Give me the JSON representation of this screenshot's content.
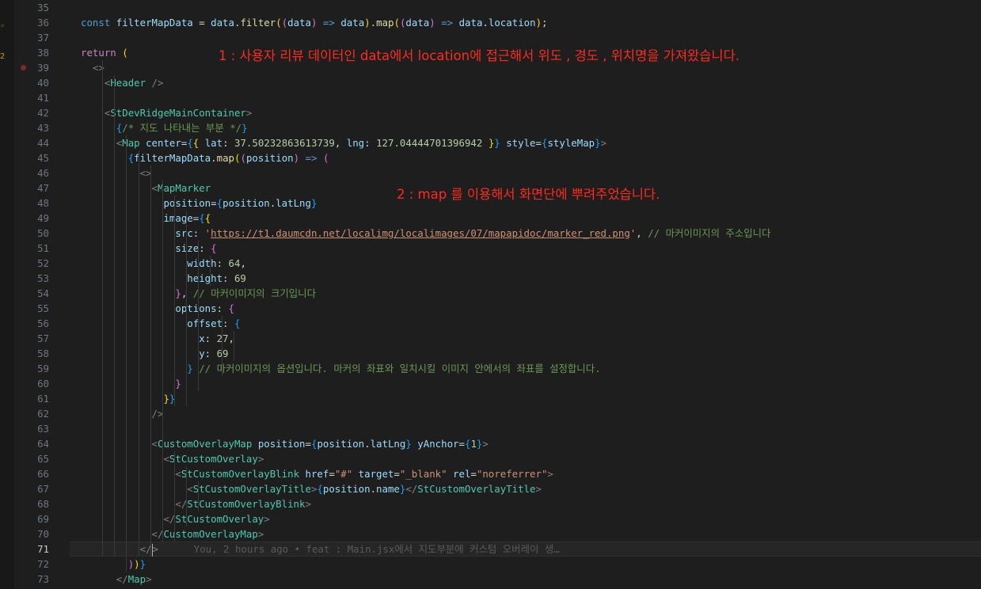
{
  "colors": {
    "background": "#1e1e1e",
    "line_number": "#6e7681",
    "keyword": "#569cd6",
    "control": "#c586c0",
    "variable": "#9cdcfe",
    "function": "#dcdcaa",
    "tag": "#4ec9b0",
    "string": "#ce9178",
    "number": "#b5cea8",
    "comment": "#6a9955",
    "annotation_red": "#ff2a1f"
  },
  "editor": {
    "current_line": 71,
    "breakpoint_line": 39,
    "line_numbers": [
      "35",
      "36",
      "37",
      "38",
      "39",
      "40",
      "41",
      "42",
      "43",
      "44",
      "45",
      "46",
      "47",
      "48",
      "49",
      "50",
      "51",
      "52",
      "53",
      "54",
      "55",
      "56",
      "57",
      "58",
      "59",
      "60",
      "61",
      "62",
      "63",
      "64",
      "65",
      "66",
      "67",
      "68",
      "69",
      "70",
      "71",
      "72",
      "73"
    ],
    "lines": [
      [],
      [
        [
          "kw",
          "const "
        ],
        [
          "var",
          "filterMapData"
        ],
        [
          "text",
          " = "
        ],
        [
          "var",
          "data"
        ],
        [
          "text",
          "."
        ],
        [
          "fn",
          "filter"
        ],
        [
          "br1",
          "("
        ],
        [
          "br2",
          "("
        ],
        [
          "var",
          "data"
        ],
        [
          "br2",
          ")"
        ],
        [
          "kw",
          " => "
        ],
        [
          "var",
          "data"
        ],
        [
          "br1",
          ")"
        ],
        [
          "text",
          "."
        ],
        [
          "fn",
          "map"
        ],
        [
          "br1",
          "("
        ],
        [
          "br2",
          "("
        ],
        [
          "var",
          "data"
        ],
        [
          "br2",
          ")"
        ],
        [
          "kw",
          " => "
        ],
        [
          "var",
          "data"
        ],
        [
          "text",
          "."
        ],
        [
          "var",
          "location"
        ],
        [
          "br1",
          ")"
        ],
        [
          "text",
          ";"
        ]
      ],
      [],
      [
        [
          "ctl",
          "return "
        ],
        [
          "br1",
          "("
        ]
      ],
      [
        [
          "text",
          "  "
        ],
        [
          "punct",
          "<>"
        ]
      ],
      [
        [
          "text",
          "    "
        ],
        [
          "punct",
          "<"
        ],
        [
          "tag",
          "Header"
        ],
        [
          "punct",
          " />"
        ]
      ],
      [],
      [
        [
          "text",
          "    "
        ],
        [
          "punct",
          "<"
        ],
        [
          "tag",
          "StDevRidgeMainContainer"
        ],
        [
          "punct",
          ">"
        ]
      ],
      [
        [
          "text",
          "      "
        ],
        [
          "br3",
          "{"
        ],
        [
          "com",
          "/* 지도 나타내는 부분 */"
        ],
        [
          "br3",
          "}"
        ]
      ],
      [
        [
          "text",
          "      "
        ],
        [
          "punct",
          "<"
        ],
        [
          "tag",
          "Map"
        ],
        [
          "attr",
          " center"
        ],
        [
          "text",
          "="
        ],
        [
          "br3",
          "{"
        ],
        [
          "br1",
          "{"
        ],
        [
          "var",
          " lat"
        ],
        [
          "text",
          ": "
        ],
        [
          "num",
          "37.50232863613739"
        ],
        [
          "text",
          ", "
        ],
        [
          "var",
          "lng"
        ],
        [
          "text",
          ": "
        ],
        [
          "num",
          "127.04444701396942"
        ],
        [
          "br1",
          " }"
        ],
        [
          "br3",
          "}"
        ],
        [
          "attr",
          " style"
        ],
        [
          "text",
          "="
        ],
        [
          "br3",
          "{"
        ],
        [
          "var",
          "styleMap"
        ],
        [
          "br3",
          "}"
        ],
        [
          "punct",
          ">"
        ]
      ],
      [
        [
          "text",
          "        "
        ],
        [
          "br3",
          "{"
        ],
        [
          "var",
          "filterMapData"
        ],
        [
          "text",
          "."
        ],
        [
          "fn",
          "map"
        ],
        [
          "br1",
          "("
        ],
        [
          "br2",
          "("
        ],
        [
          "var",
          "position"
        ],
        [
          "br2",
          ")"
        ],
        [
          "kw",
          " => "
        ],
        [
          "br2",
          "("
        ]
      ],
      [
        [
          "text",
          "          "
        ],
        [
          "punct",
          "<>"
        ]
      ],
      [
        [
          "text",
          "            "
        ],
        [
          "punct",
          "<"
        ],
        [
          "tag",
          "MapMarker"
        ]
      ],
      [
        [
          "text",
          "              "
        ],
        [
          "attr",
          "position"
        ],
        [
          "text",
          "="
        ],
        [
          "br3",
          "{"
        ],
        [
          "var",
          "position"
        ],
        [
          "text",
          "."
        ],
        [
          "var",
          "latLng"
        ],
        [
          "br3",
          "}"
        ]
      ],
      [
        [
          "text",
          "              "
        ],
        [
          "attr",
          "image"
        ],
        [
          "text",
          "="
        ],
        [
          "br3",
          "{"
        ],
        [
          "br1",
          "{"
        ]
      ],
      [
        [
          "text",
          "                "
        ],
        [
          "var",
          "src"
        ],
        [
          "text",
          ": "
        ],
        [
          "str",
          "'"
        ],
        [
          "url",
          "https://t1.daumcdn.net/localimg/localimages/07/mapapidoc/marker_red.png"
        ],
        [
          "str",
          "'"
        ],
        [
          "text",
          ", "
        ],
        [
          "com",
          "// 마커이미지의 주소입니다"
        ]
      ],
      [
        [
          "text",
          "                "
        ],
        [
          "var",
          "size"
        ],
        [
          "text",
          ": "
        ],
        [
          "br2",
          "{"
        ]
      ],
      [
        [
          "text",
          "                  "
        ],
        [
          "var",
          "width"
        ],
        [
          "text",
          ": "
        ],
        [
          "num",
          "64"
        ],
        [
          "text",
          ","
        ]
      ],
      [
        [
          "text",
          "                  "
        ],
        [
          "var",
          "height"
        ],
        [
          "text",
          ": "
        ],
        [
          "num",
          "69"
        ]
      ],
      [
        [
          "text",
          "                "
        ],
        [
          "br2",
          "}"
        ],
        [
          "text",
          ", "
        ],
        [
          "com",
          "// 마커이미지의 크기입니다"
        ]
      ],
      [
        [
          "text",
          "                "
        ],
        [
          "var",
          "options"
        ],
        [
          "text",
          ": "
        ],
        [
          "br2",
          "{"
        ]
      ],
      [
        [
          "text",
          "                  "
        ],
        [
          "var",
          "offset"
        ],
        [
          "text",
          ": "
        ],
        [
          "br3",
          "{"
        ]
      ],
      [
        [
          "text",
          "                    "
        ],
        [
          "var",
          "x"
        ],
        [
          "text",
          ": "
        ],
        [
          "num",
          "27"
        ],
        [
          "text",
          ","
        ]
      ],
      [
        [
          "text",
          "                    "
        ],
        [
          "var",
          "y"
        ],
        [
          "text",
          ": "
        ],
        [
          "num",
          "69"
        ]
      ],
      [
        [
          "text",
          "                  "
        ],
        [
          "br3",
          "}"
        ],
        [
          "com",
          " // 마커이미지의 옵션입니다. 마커의 좌표와 일치시킬 이미지 안에서의 좌표를 설정합니다."
        ]
      ],
      [
        [
          "text",
          "                "
        ],
        [
          "br2",
          "}"
        ]
      ],
      [
        [
          "text",
          "              "
        ],
        [
          "br1",
          "}"
        ],
        [
          "br3",
          "}"
        ]
      ],
      [
        [
          "text",
          "            "
        ],
        [
          "punct",
          "/>"
        ]
      ],
      [],
      [
        [
          "text",
          "            "
        ],
        [
          "punct",
          "<"
        ],
        [
          "tag",
          "CustomOverlayMap"
        ],
        [
          "attr",
          " position"
        ],
        [
          "text",
          "="
        ],
        [
          "br3",
          "{"
        ],
        [
          "var",
          "position"
        ],
        [
          "text",
          "."
        ],
        [
          "var",
          "latLng"
        ],
        [
          "br3",
          "}"
        ],
        [
          "attr",
          " yAnchor"
        ],
        [
          "text",
          "="
        ],
        [
          "br3",
          "{"
        ],
        [
          "num",
          "1"
        ],
        [
          "br3",
          "}"
        ],
        [
          "punct",
          ">"
        ]
      ],
      [
        [
          "text",
          "              "
        ],
        [
          "punct",
          "<"
        ],
        [
          "tag",
          "StCustomOverlay"
        ],
        [
          "punct",
          ">"
        ]
      ],
      [
        [
          "text",
          "                "
        ],
        [
          "punct",
          "<"
        ],
        [
          "tag",
          "StCustomOverlayBlink"
        ],
        [
          "attr",
          " href"
        ],
        [
          "text",
          "="
        ],
        [
          "str",
          "\"#\""
        ],
        [
          "attr",
          " target"
        ],
        [
          "text",
          "="
        ],
        [
          "str",
          "\"_blank\""
        ],
        [
          "attr",
          " rel"
        ],
        [
          "text",
          "="
        ],
        [
          "str",
          "\"noreferrer\""
        ],
        [
          "punct",
          ">"
        ]
      ],
      [
        [
          "text",
          "                  "
        ],
        [
          "punct",
          "<"
        ],
        [
          "tag",
          "StCustomOverlayTitle"
        ],
        [
          "punct",
          ">"
        ],
        [
          "br3",
          "{"
        ],
        [
          "var",
          "position"
        ],
        [
          "text",
          "."
        ],
        [
          "var",
          "name"
        ],
        [
          "br3",
          "}"
        ],
        [
          "punct",
          "</"
        ],
        [
          "tag",
          "StCustomOverlayTitle"
        ],
        [
          "punct",
          ">"
        ]
      ],
      [
        [
          "text",
          "                "
        ],
        [
          "punct",
          "</"
        ],
        [
          "tag",
          "StCustomOverlayBlink"
        ],
        [
          "punct",
          ">"
        ]
      ],
      [
        [
          "text",
          "              "
        ],
        [
          "punct",
          "</"
        ],
        [
          "tag",
          "StCustomOverlay"
        ],
        [
          "punct",
          ">"
        ]
      ],
      [
        [
          "text",
          "            "
        ],
        [
          "punct",
          "</"
        ],
        [
          "tag",
          "CustomOverlayMap"
        ],
        [
          "punct",
          ">"
        ]
      ],
      [
        [
          "text",
          "          "
        ],
        [
          "punct",
          "</"
        ],
        [
          "cursor",
          ""
        ],
        [
          "punct",
          ">"
        ],
        [
          "blame",
          "      You, 2 hours ago • feat : Main.jsx에서 지도부분에 커스텀 오버레이 생…"
        ]
      ],
      [
        [
          "text",
          "        "
        ],
        [
          "br2",
          ")"
        ],
        [
          "br1",
          ")"
        ],
        [
          "br3",
          "}"
        ]
      ],
      [
        [
          "text",
          "      "
        ],
        [
          "punct",
          "</"
        ],
        [
          "tag",
          "Map"
        ],
        [
          "punct",
          ">"
        ]
      ]
    ]
  },
  "annotations": [
    {
      "text": "1 : 사용자 리뷰 데이터인 data에서  location에 접근해서  위도 , 경도 , 위치명을  가져왔습니다."
    },
    {
      "text": "2 : map 를 이용해서  화면단에  뿌려주었습니다."
    }
  ]
}
